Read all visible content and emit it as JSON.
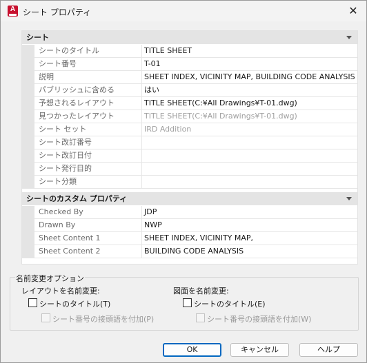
{
  "window": {
    "title": "シート プロパティ",
    "close_glyph": "✕"
  },
  "categories": [
    {
      "label": "シート",
      "rows": [
        {
          "name": "シートのタイトル",
          "value": "TITLE SHEET",
          "dim": false
        },
        {
          "name": "シート番号",
          "value": "T-01",
          "dim": false
        },
        {
          "name": "説明",
          "value": "SHEET INDEX, VICINITY MAP, BUILDING CODE ANALYSIS",
          "dim": false
        },
        {
          "name": "パブリッシュに含める",
          "value": "はい",
          "dim": false
        },
        {
          "name": "予想されるレイアウト",
          "value": "TITLE SHEET(C:¥All Drawings¥T-01.dwg)",
          "dim": false
        },
        {
          "name": "見つかったレイアウト",
          "value": "TITLE SHEET(C:¥All Drawings¥T-01.dwg)",
          "dim": true
        },
        {
          "name": "シート セット",
          "value": "IRD Addition",
          "dim": true
        },
        {
          "name": "シート改訂番号",
          "value": "",
          "dim": false
        },
        {
          "name": "シート改訂日付",
          "value": "",
          "dim": false
        },
        {
          "name": "シート発行目的",
          "value": "",
          "dim": false
        },
        {
          "name": "シート分類",
          "value": "",
          "dim": false
        }
      ]
    },
    {
      "label": "シートのカスタム プロパティ",
      "rows": [
        {
          "name": "Checked By",
          "value": "JDP",
          "dim": false
        },
        {
          "name": "Drawn By",
          "value": "NWP",
          "dim": false
        },
        {
          "name": "Sheet Content 1",
          "value": "SHEET INDEX, VICINITY MAP,",
          "dim": false
        },
        {
          "name": "Sheet Content 2",
          "value": "BUILDING CODE ANALYSIS",
          "dim": false
        }
      ]
    }
  ],
  "rename_options": {
    "legend": "名前変更オプション",
    "layout_heading": "レイアウトを名前変更:",
    "drawing_heading": "図面を名前変更:",
    "layout_title_checkbox": {
      "label": "シートのタイトル(T)",
      "checked": false
    },
    "layout_prefix_checkbox": {
      "label": "シート番号の接頭語を付加(P)",
      "checked": false,
      "disabled": true
    },
    "drawing_title_checkbox": {
      "label": "シートのタイトル(E)",
      "checked": false
    },
    "drawing_prefix_checkbox": {
      "label": "シート番号の接頭語を付加(W)",
      "checked": false,
      "disabled": true
    }
  },
  "buttons": {
    "ok": "OK",
    "cancel": "キャンセル",
    "help": "ヘルプ"
  },
  "colors": {
    "accent": "#0067c0",
    "app_icon": "#c8102e",
    "category_bg": "#e4e4e4"
  },
  "icons": {
    "app": "autocad-a-icon",
    "close": "close-icon",
    "collapse": "collapse-triangle-icon"
  }
}
